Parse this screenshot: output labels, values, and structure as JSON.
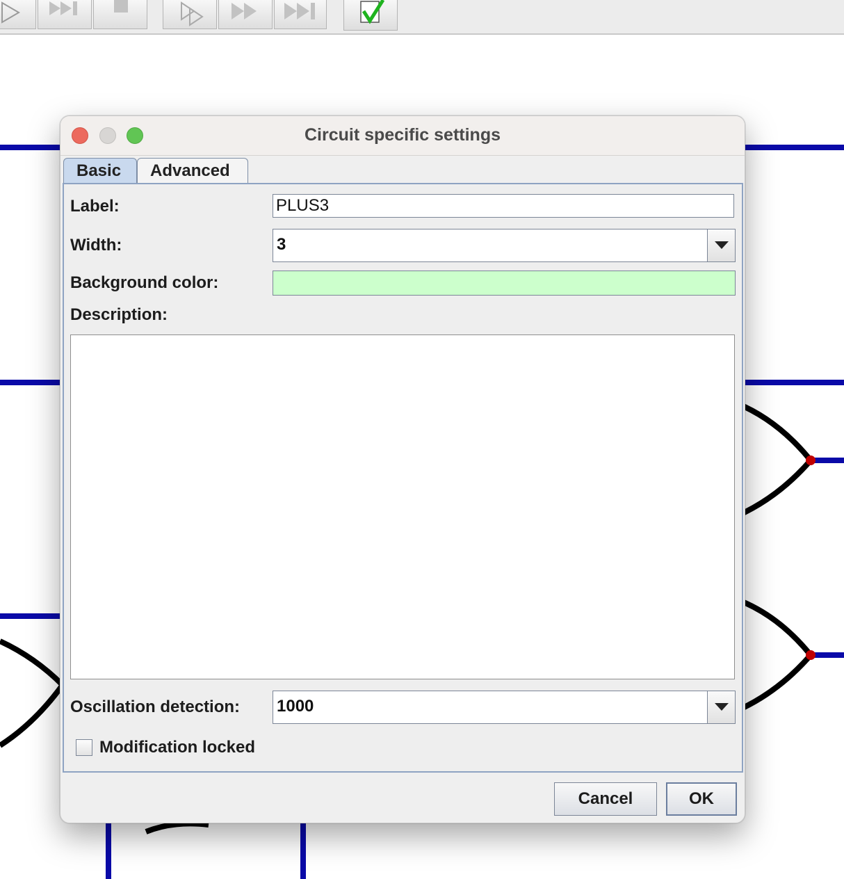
{
  "toolbar": {
    "buttons": [
      {
        "icon": "play-icon"
      },
      {
        "icon": "step-forward-icon"
      },
      {
        "icon": "stop-icon"
      },
      {
        "icon": "run-to-break-icon"
      },
      {
        "icon": "fast-forward-icon"
      },
      {
        "icon": "skip-end-icon"
      },
      {
        "icon": "check-icon",
        "accent": "#1fb31f"
      }
    ]
  },
  "colors": {
    "wire": "#0a0aa8",
    "junction": "#c00000",
    "gate": "#000000",
    "background_color_value": "#ccffcc",
    "tab_active": "#c9d9ee"
  },
  "dialog": {
    "title": "Circuit specific settings",
    "tabs": [
      {
        "label": "Basic",
        "selected": true
      },
      {
        "label": "Advanced",
        "selected": false
      }
    ],
    "fields": {
      "label": {
        "label": "Label:",
        "value": "PLUS3"
      },
      "width": {
        "label": "Width:",
        "value": "3"
      },
      "background_color": {
        "label": "Background color:"
      },
      "description": {
        "label": "Description:",
        "value": ""
      },
      "oscillation_detection": {
        "label": "Oscillation detection:",
        "value": "1000"
      },
      "modification_locked": {
        "label": "Modification locked",
        "checked": false
      }
    },
    "buttons": {
      "cancel": "Cancel",
      "ok": "OK"
    }
  }
}
